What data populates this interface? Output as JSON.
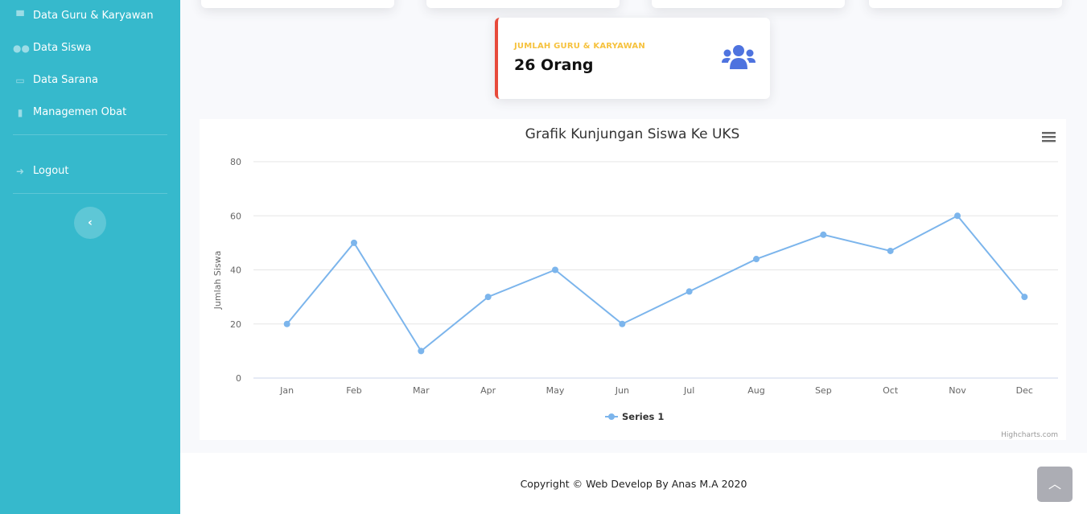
{
  "sidebar": {
    "items": [
      {
        "label": "Data Guru & Karyawan",
        "icon": "user-graduate-icon"
      },
      {
        "label": "Data Siswa",
        "icon": "users-icon"
      },
      {
        "label": "Data Sarana",
        "icon": "bed-icon"
      },
      {
        "label": "Managemen Obat",
        "icon": "medicine-icon"
      }
    ],
    "logout": "Logout",
    "toggle_icon": "chevron-left-icon"
  },
  "stat_card": {
    "label": "JUMLAH GURU & KARYAWAN",
    "value": "26 Orang",
    "icon": "users-icon",
    "accent": "#e74a3b",
    "label_color": "#f6c23e",
    "icon_color": "#4e73df"
  },
  "chart_data": {
    "type": "line",
    "title": "Grafik Kunjungan Siswa Ke UKS",
    "xlabel": "",
    "ylabel": "Jumlah Siswa",
    "categories": [
      "Jan",
      "Feb",
      "Mar",
      "Apr",
      "May",
      "Jun",
      "Jul",
      "Aug",
      "Sep",
      "Oct",
      "Nov",
      "Dec"
    ],
    "series": [
      {
        "name": "Series 1",
        "values": [
          20,
          50,
          10,
          30,
          40,
          20,
          32,
          44,
          53,
          47,
          60,
          30
        ],
        "color": "#7cb5ec"
      }
    ],
    "ylim": [
      0,
      80
    ],
    "yticks": [
      0,
      20,
      40,
      60,
      80
    ],
    "grid": true,
    "legend": "bottom-center",
    "credits": "Highcharts.com"
  },
  "footer": {
    "copyright": "Copyright © Web Develop By Anas M.A 2020"
  }
}
